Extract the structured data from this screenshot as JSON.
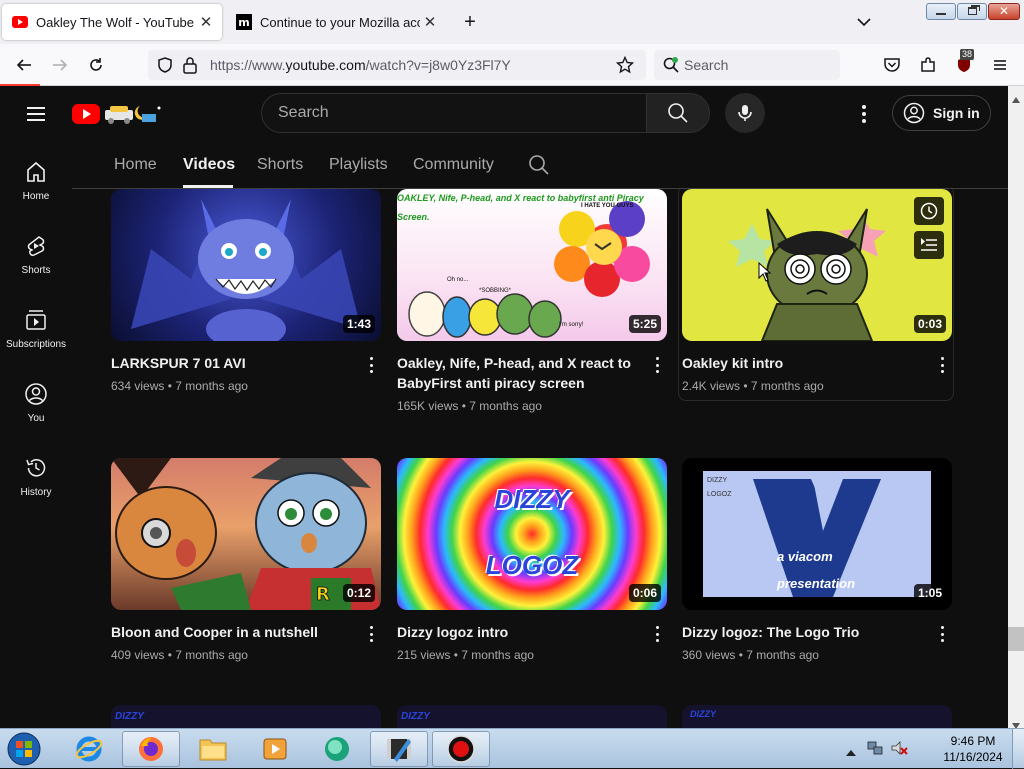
{
  "browser": {
    "tabs": [
      {
        "title": "Oakley The Wolf - YouTube",
        "active": true
      },
      {
        "title": "Continue to your Mozilla account",
        "active": false
      }
    ],
    "url_prefix": "https://www.",
    "url_domain": "youtube.com",
    "url_path": "/watch?v=j8w0Yz3Fl7Y",
    "search_placeholder": "Search",
    "extension_badge": "38"
  },
  "youtube": {
    "search_placeholder": "Search",
    "sign_in_label": "Sign in",
    "sidebar": [
      {
        "label": "Home",
        "icon": "home-icon"
      },
      {
        "label": "Shorts",
        "icon": "shorts-icon"
      },
      {
        "label": "Subscriptions",
        "icon": "subscriptions-icon"
      },
      {
        "label": "You",
        "icon": "you-icon"
      },
      {
        "label": "History",
        "icon": "history-icon"
      }
    ],
    "channel_tabs": [
      "Home",
      "Videos",
      "Shorts",
      "Playlists",
      "Community"
    ],
    "active_tab": "Videos",
    "videos": [
      {
        "title": "LARKSPUR 7 01 AVI",
        "views": "634 views",
        "age": "7 months ago",
        "duration": "1:43"
      },
      {
        "title": "Oakley, Nife, P-head, and X react to BabyFirst anti piracy screen",
        "views": "165K views",
        "age": "7 months ago",
        "duration": "5:25",
        "thumb_text": "OAKLEY, Nife, P-head, and X react to babyfirst anti Piracy Screen.",
        "thumb_quotes": [
          "I HATE YOU GUYS",
          "Oh no...",
          "*SOBBING*",
          "I'm sorry!"
        ]
      },
      {
        "title": "Oakley kit intro",
        "views": "2.4K views",
        "age": "7 months ago",
        "duration": "0:03"
      },
      {
        "title": "Bloon and Cooper in a nutshell",
        "views": "409 views",
        "age": "7 months ago",
        "duration": "0:12"
      },
      {
        "title": "Dizzy logoz intro",
        "views": "215 views",
        "age": "7 months ago",
        "duration": "0:06",
        "thumb_text_1": "DIZZY",
        "thumb_text_2": "LOGOZ"
      },
      {
        "title": "Dizzy logoz: The Logo Trio",
        "views": "360 views",
        "age": "7 months ago",
        "duration": "1:05",
        "thumb_text_1": "DIZZY",
        "thumb_text_2": "LOGOZ",
        "thumb_text_3": "a viacom",
        "thumb_text_4": "presentation"
      }
    ],
    "partial_row_texts": [
      "DIZZY",
      "DIZZY",
      "DIZZY"
    ]
  },
  "taskbar": {
    "time": "9:46 PM",
    "date": "11/16/2024"
  },
  "colors": {
    "yt_bg": "#0f0f0f",
    "yt_red": "#ff0000",
    "taskbar": "#b9d1ea"
  }
}
